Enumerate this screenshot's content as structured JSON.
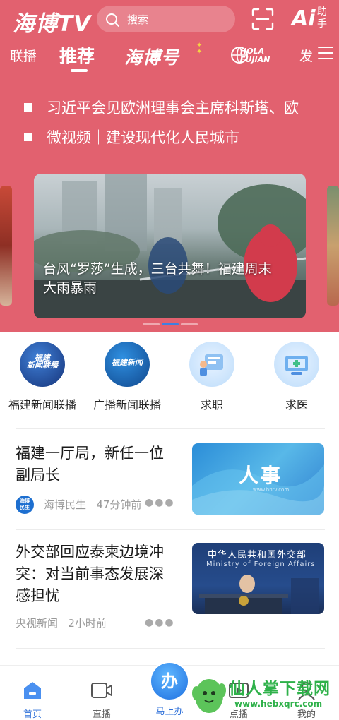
{
  "header": {
    "logo": "海博TV",
    "search_placeholder": "搜索",
    "ai_label": "Ai",
    "ai_sub": "助手"
  },
  "tabs": [
    {
      "label": "联播"
    },
    {
      "label": "推荐",
      "active": true
    },
    {
      "label": "海博号"
    },
    {
      "label": "HOLA FUJIAN"
    },
    {
      "label": "发"
    }
  ],
  "headlines": [
    "习近平会见欧洲理事会主席科斯塔、欧",
    "微视频｜建设现代化人民城市"
  ],
  "carousel": {
    "caption": "台风“罗莎”生成，三台共舞！福建周末大雨暴雨",
    "active_dot": 1,
    "dot_count": 3
  },
  "services": [
    {
      "label": "福建新闻联播",
      "icon": "fujian-news-icon",
      "inner": "福建\n新闻联播"
    },
    {
      "label": "广播新闻联播",
      "icon": "radio-news-icon",
      "inner": "福建新闻"
    },
    {
      "label": "求职",
      "icon": "job-icon"
    },
    {
      "label": "求医",
      "icon": "medical-icon"
    }
  ],
  "articles": [
    {
      "title": "福建一厅局，新任一位副局长",
      "source": "海博民生",
      "time": "47分钟前",
      "avatar_text": "海博\n民生",
      "thumb_text": "人事"
    },
    {
      "title": "外交部回应泰柬边境冲突：对当前事态发展深感担忧",
      "source": "央视新闻",
      "time": "2小时前",
      "thumb_cn": "中华人民共和国外交部",
      "thumb_en": "Ministry of Foreign Affairs"
    }
  ],
  "bottom_nav": [
    {
      "label": "首页",
      "icon": "home-icon",
      "active": true
    },
    {
      "label": "直播",
      "icon": "video-camera-icon"
    },
    {
      "label": "马上办",
      "icon": "ban-icon",
      "center_text": "办"
    },
    {
      "label": "点播",
      "icon": "vod-icon"
    },
    {
      "label": "我的",
      "icon": "profile-icon"
    }
  ],
  "watermark": {
    "main": "仙人掌下载网",
    "url": "www.hebxqrc.com"
  },
  "colors": {
    "brand": "#e2616f",
    "accent": "#2d6fd8"
  }
}
